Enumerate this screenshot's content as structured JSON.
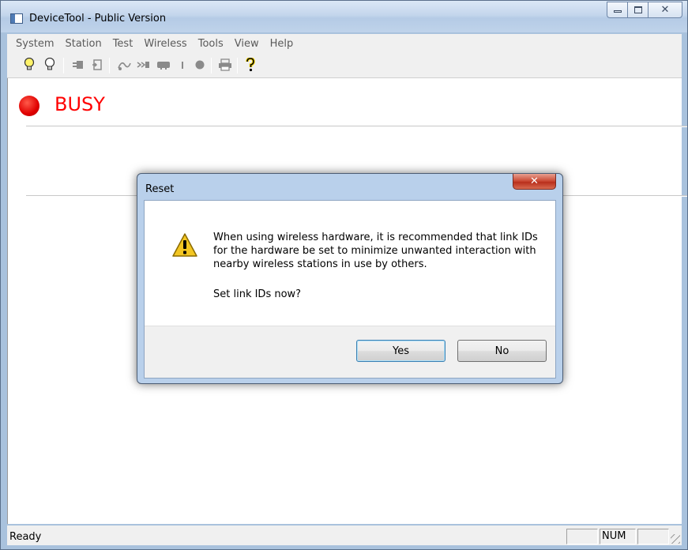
{
  "window": {
    "title": "DeviceTool - Public Version",
    "buttons": {
      "minimize": "minimize",
      "maximize": "maximize",
      "close": "✕"
    }
  },
  "menubar": [
    "System",
    "Station",
    "Test",
    "Wireless",
    "Tools",
    "View",
    "Help"
  ],
  "toolbar": {
    "icons": [
      "lightbulb-on-icon",
      "lightbulb-off-icon",
      "plug-icon",
      "document-icon",
      "wireless-icon",
      "signal-icon",
      "device-icon",
      "line-icon",
      "record-icon",
      "print-icon",
      "help-icon"
    ]
  },
  "content": {
    "status_label": "BUSY",
    "status_color": "#ff0000"
  },
  "statusbar": {
    "text": "Ready",
    "panes": [
      "",
      "NUM",
      ""
    ]
  },
  "dialog": {
    "title": "Reset",
    "close": "✕",
    "message": "When using wireless hardware, it is recommended that link IDs for the hardware be set to minimize unwanted interaction with nearby wireless stations in use by others.",
    "question": "Set link IDs now?",
    "yes_label": "Yes",
    "no_label": "No"
  }
}
